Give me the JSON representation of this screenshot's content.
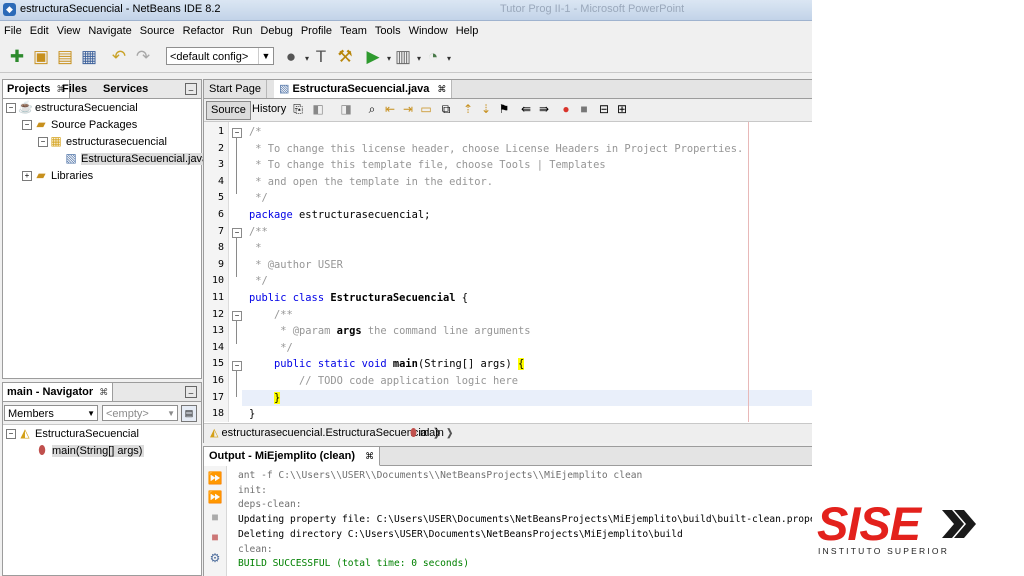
{
  "window": {
    "title": "estructuraSecuencial - NetBeans IDE 8.2",
    "background_title": "Tutor Prog  II-1 - Microsoft PowerPoint"
  },
  "menu": [
    "File",
    "Edit",
    "View",
    "Navigate",
    "Source",
    "Refactor",
    "Run",
    "Debug",
    "Profile",
    "Team",
    "Tools",
    "Window",
    "Help"
  ],
  "toolbar": {
    "config_value": "<default config>",
    "icons": [
      "new-file-icon",
      "new-project-icon",
      "open-project-icon",
      "save-all-icon",
      "undo-icon",
      "redo-icon",
      "globe-icon",
      "build-hammer-icon",
      "clean-build-icon",
      "run-icon",
      "debug-icon",
      "profile-icon"
    ]
  },
  "projects_panel": {
    "tabs": [
      {
        "label": "Projects"
      },
      {
        "label": "Files"
      },
      {
        "label": "Services"
      }
    ],
    "tree": [
      {
        "label": "estructuraSecuencial",
        "icon": "project-icon"
      },
      {
        "label": "Source Packages",
        "icon": "source-packages-icon"
      },
      {
        "label": "estructurasecuencial",
        "icon": "package-icon"
      },
      {
        "label": "EstructuraSecuencial.java",
        "icon": "java-file-icon"
      },
      {
        "label": "Libraries",
        "icon": "libraries-icon"
      }
    ]
  },
  "navigator": {
    "title": "main - Navigator",
    "filter_value": "Members",
    "empty_value": "<empty>",
    "tree": [
      {
        "label": "EstructuraSecuencial",
        "icon": "class-icon"
      },
      {
        "label": "main(String[] args)",
        "icon": "method-icon"
      }
    ]
  },
  "editor": {
    "tabs": [
      {
        "label": "Start Page"
      },
      {
        "label": "EstructuraSecuencial.java"
      }
    ],
    "source_label": "Source",
    "history_label": "History",
    "line_numbers": [
      "1",
      "2",
      "3",
      "4",
      "5",
      "6",
      "7",
      "8",
      "9",
      "10",
      "11",
      "12",
      "13",
      "14",
      "15",
      "16",
      "17",
      "18"
    ],
    "code": [
      "/*",
      " * To change this license header, choose License Headers in Project Properties.",
      " * To change this template file, choose Tools | Templates",
      " * and open the template in the editor.",
      " */",
      "package estructurasecuencial;",
      "/**",
      " *",
      " * @author USER",
      " */",
      "public class EstructuraSecuencial {",
      "    /**",
      "     * @param args the command line arguments",
      "     */",
      "    public static void main(String[] args) {",
      "        // TODO code application logic here",
      "    }",
      "}"
    ],
    "breadcrumb": [
      "estructurasecuencial.EstructuraSecuencial",
      "main"
    ]
  },
  "output": {
    "tab_label": "Output - MiEjemplito (clean)",
    "lines": [
      "ant -f C:\\\\Users\\\\USER\\\\Documents\\\\NetBeansProjects\\\\MiEjemplito clean",
      "init:",
      "deps-clean:",
      "Updating property file: C:\\Users\\USER\\Documents\\NetBeansProjects\\MiEjemplito\\build\\built-clean.properties",
      "Deleting directory C:\\Users\\USER\\Documents\\NetBeansProjects\\MiEjemplito\\build",
      "clean:",
      "BUILD SUCCESSFUL (total time: 0 seconds)"
    ]
  },
  "logo": {
    "word": "SISE",
    "subtitle": "INSTITUTO SUPERIOR",
    "color": "#e3211c"
  }
}
